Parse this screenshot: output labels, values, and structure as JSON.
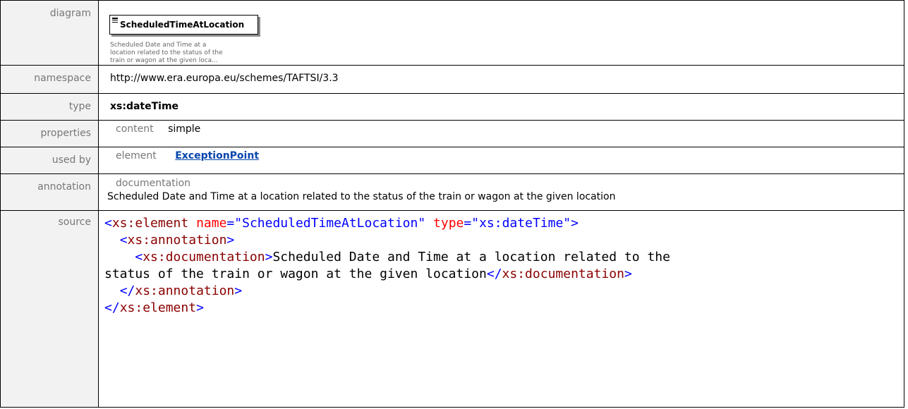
{
  "labels": {
    "diagram": "diagram",
    "namespace": "namespace",
    "type": "type",
    "properties": "properties",
    "used_by": "used by",
    "annotation": "annotation",
    "source": "source"
  },
  "diagram": {
    "element_name": "ScheduledTimeAtLocation",
    "description": "Scheduled Date and Time at a location related to the status of the train or wagon at the given loca..."
  },
  "namespace": "http://www.era.europa.eu/schemes/TAFTSI/3.3",
  "type": "xs:dateTime",
  "properties": {
    "key": "content",
    "value": "simple"
  },
  "used_by": {
    "key": "element",
    "value": "ExceptionPoint"
  },
  "annotation": {
    "key": "documentation",
    "value": "Scheduled Date and Time at a location related to the status of the train or wagon at the given location"
  },
  "source": {
    "l1_open": "<",
    "l1_tag": "xs:element",
    "l1_attr1": "name",
    "l1_eq1": "=",
    "l1_val1": "\"ScheduledTimeAtLocation\"",
    "l1_attr2": "type",
    "l1_eq2": "=",
    "l1_val2": "\"xs:dateTime\"",
    "l1_close": ">",
    "l2_open": "<",
    "l2_tag": "xs:annotation",
    "l2_close": ">",
    "l3_open": "<",
    "l3_tag": "xs:documentation",
    "l3_close": ">",
    "l3_text": "Scheduled Date and Time at a location related to the",
    "l4_text": "status of the train or wagon at the given location",
    "l4_open": "</",
    "l4_tag": "xs:documentation",
    "l4_close": ">",
    "l5_open": "</",
    "l5_tag": "xs:annotation",
    "l5_close": ">",
    "l6_open": "</",
    "l6_tag": "xs:element",
    "l6_close": ">"
  }
}
